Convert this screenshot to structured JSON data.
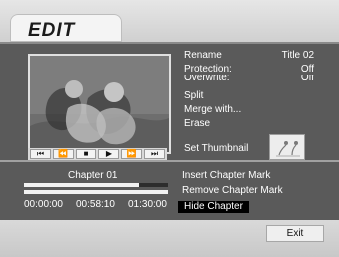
{
  "header": {
    "title": "EDIT"
  },
  "menu": {
    "items": [
      {
        "label": "Rename",
        "value": "Title 02"
      },
      {
        "label": "Protection:",
        "value": "Off"
      },
      {
        "label": "Overwrite:",
        "value": "Off"
      },
      {
        "label": "Split",
        "value": ""
      },
      {
        "label": "Merge with...",
        "value": ""
      },
      {
        "label": "Erase",
        "value": ""
      },
      {
        "label": "Set Thumbnail",
        "value": ""
      }
    ]
  },
  "transport": {
    "buttons": [
      {
        "icon": "skip-back-icon",
        "glyph": "⏮"
      },
      {
        "icon": "rewind-icon",
        "glyph": "⏪"
      },
      {
        "icon": "stop-icon",
        "glyph": "■"
      },
      {
        "icon": "play-icon",
        "glyph": "▶"
      },
      {
        "icon": "fast-forward-icon",
        "glyph": "⏩"
      },
      {
        "icon": "skip-forward-icon",
        "glyph": "⏭"
      }
    ]
  },
  "chapter": {
    "label": "Chapter 01",
    "times": [
      "00:00:00",
      "00:58:10",
      "01:30:00"
    ],
    "progress": 0.8
  },
  "chapter_menu": {
    "items": [
      "Insert Chapter Mark",
      "Remove Chapter Mark",
      "Hide Chapter"
    ],
    "selected_index": 2
  },
  "footer": {
    "exit_label": "Exit"
  }
}
